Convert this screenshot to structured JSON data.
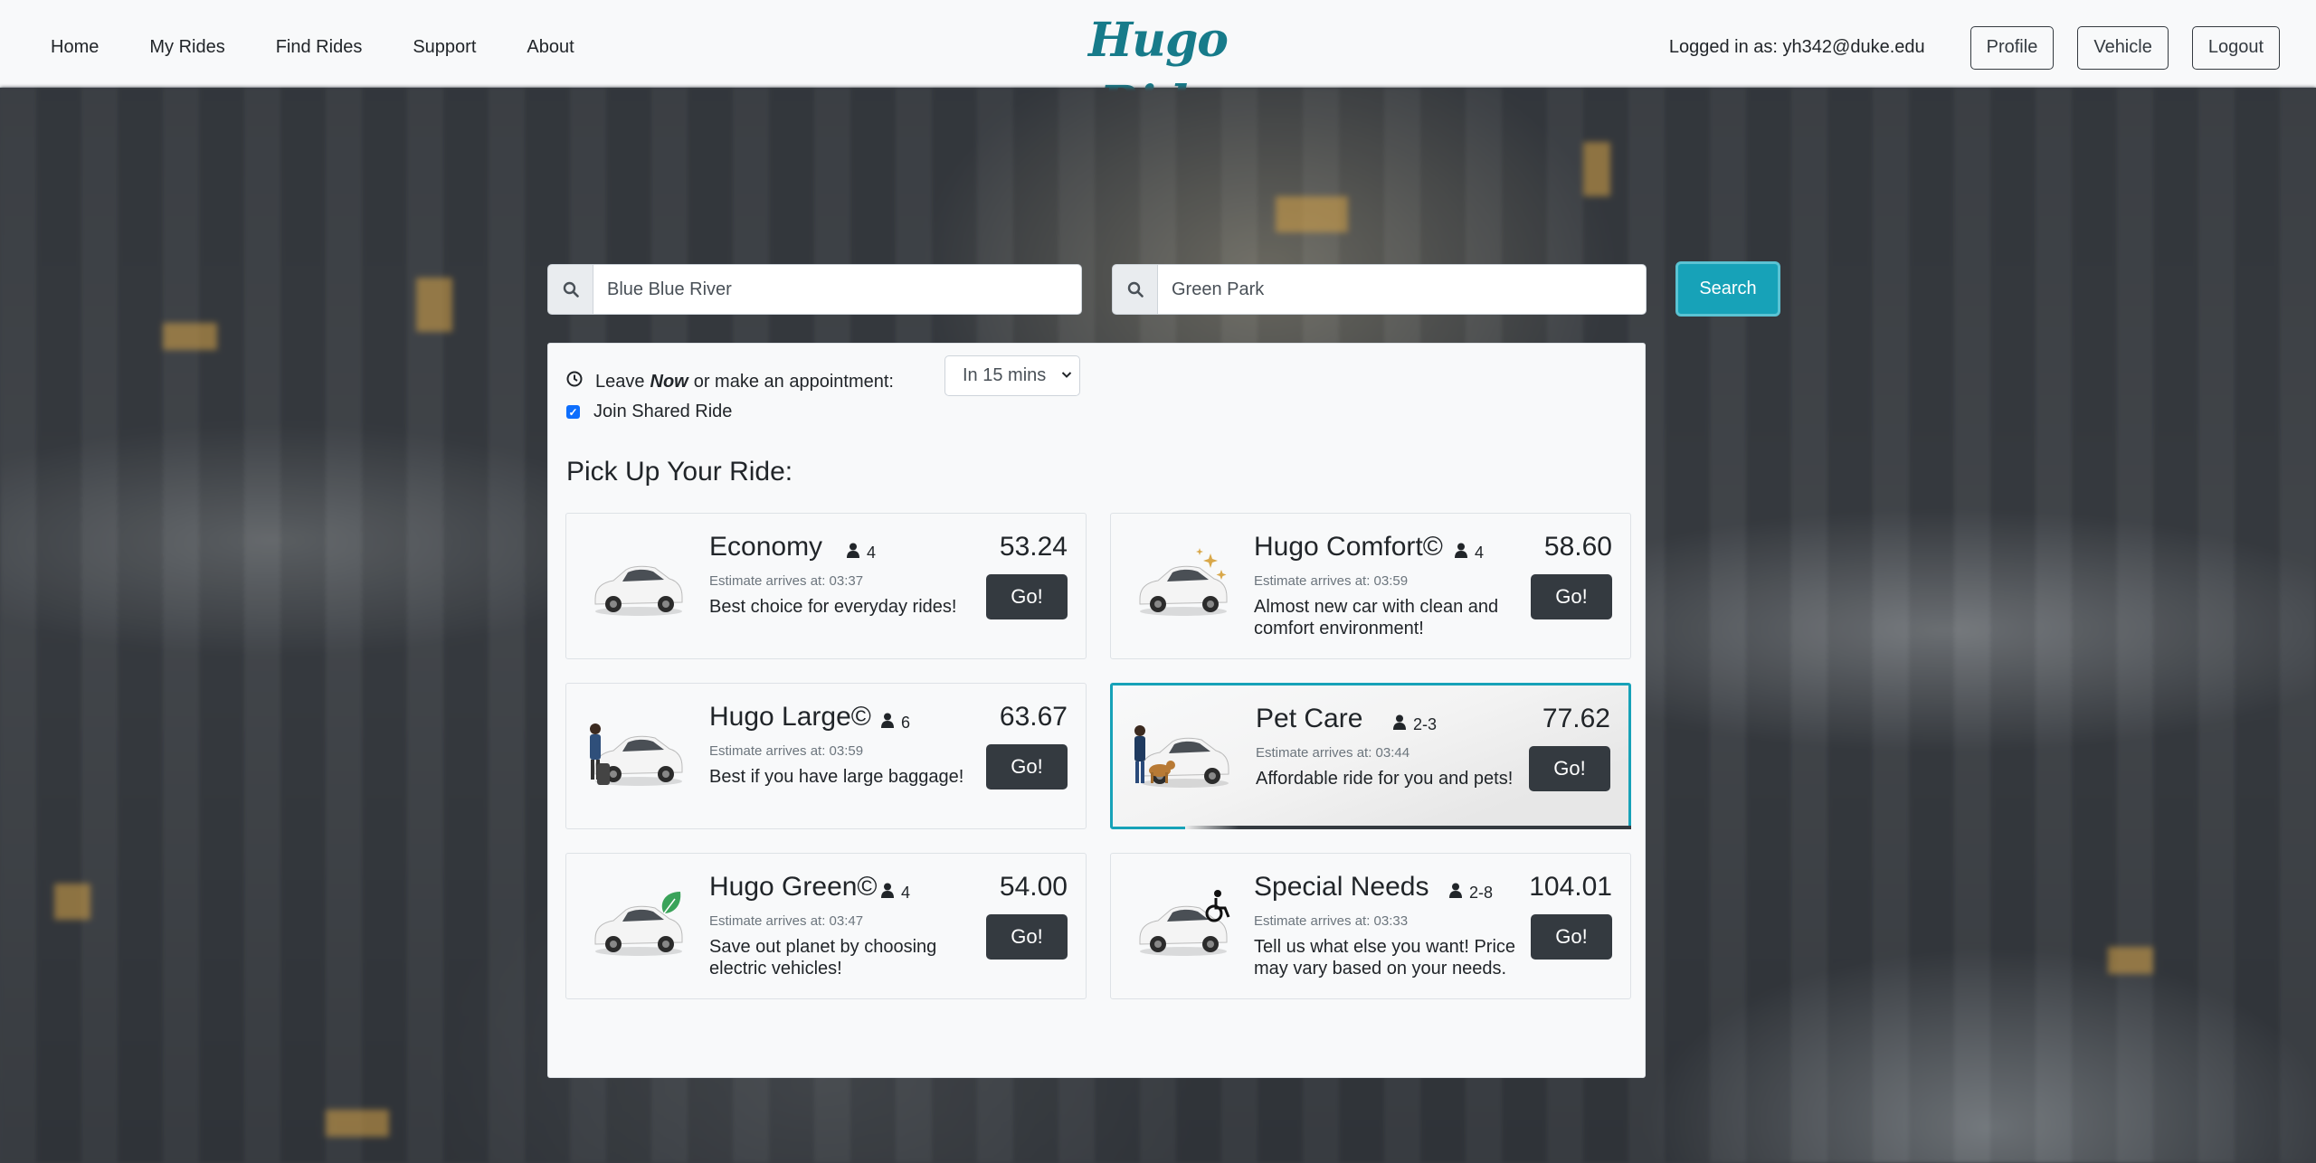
{
  "nav": {
    "links": [
      "Home",
      "My Rides",
      "Find Rides",
      "Support",
      "About"
    ],
    "brand": "Hugo Ride",
    "logged_in": "Logged in as: yh342@duke.edu",
    "profile": "Profile",
    "vehicle": "Vehicle",
    "logout": "Logout"
  },
  "search": {
    "from_value": "Blue Blue River",
    "to_value": "Green Park",
    "button": "Search"
  },
  "options": {
    "leave_prefix": "Leave",
    "leave_now": "Now",
    "leave_suffix": "or make an appointment:",
    "appointment": "In 15 mins",
    "shared_label": "Join Shared Ride",
    "shared_checked": true
  },
  "pick_title": "Pick Up Your Ride:",
  "accent_color": "#17a2b8",
  "rides": [
    {
      "title": "Economy",
      "capacity": "4",
      "eta": "Estimate arrives at: 03:37",
      "desc": "Best choice for everyday rides!",
      "price": "53.24",
      "go": "Go!",
      "extra": "none"
    },
    {
      "title": "Hugo Comfort©",
      "capacity": "4",
      "eta": "Estimate arrives at: 03:59",
      "desc": "Almost new car with clean and comfort environment!",
      "price": "58.60",
      "go": "Go!",
      "extra": "sparkles"
    },
    {
      "title": "Hugo Large©",
      "capacity": "6",
      "eta": "Estimate arrives at: 03:59",
      "desc": "Best if you have large baggage!",
      "price": "63.67",
      "go": "Go!",
      "extra": "person-luggage"
    },
    {
      "title": "Pet Care",
      "capacity": "2-3",
      "eta": "Estimate arrives at: 03:44",
      "desc": "Affordable ride for you and pets!",
      "price": "77.62",
      "go": "Go!",
      "extra": "person-dog"
    },
    {
      "title": "Hugo Green©",
      "capacity": "4",
      "eta": "Estimate arrives at: 03:47",
      "desc": "Save out planet by choosing electric vehicles!",
      "price": "54.00",
      "go": "Go!",
      "extra": "leaf"
    },
    {
      "title": "Special Needs",
      "capacity": "2-8",
      "eta": "Estimate arrives at: 03:33",
      "desc": "Tell us what else you want! Price may vary based on your needs.",
      "price": "104.01",
      "go": "Go!",
      "extra": "wheelchair"
    }
  ]
}
